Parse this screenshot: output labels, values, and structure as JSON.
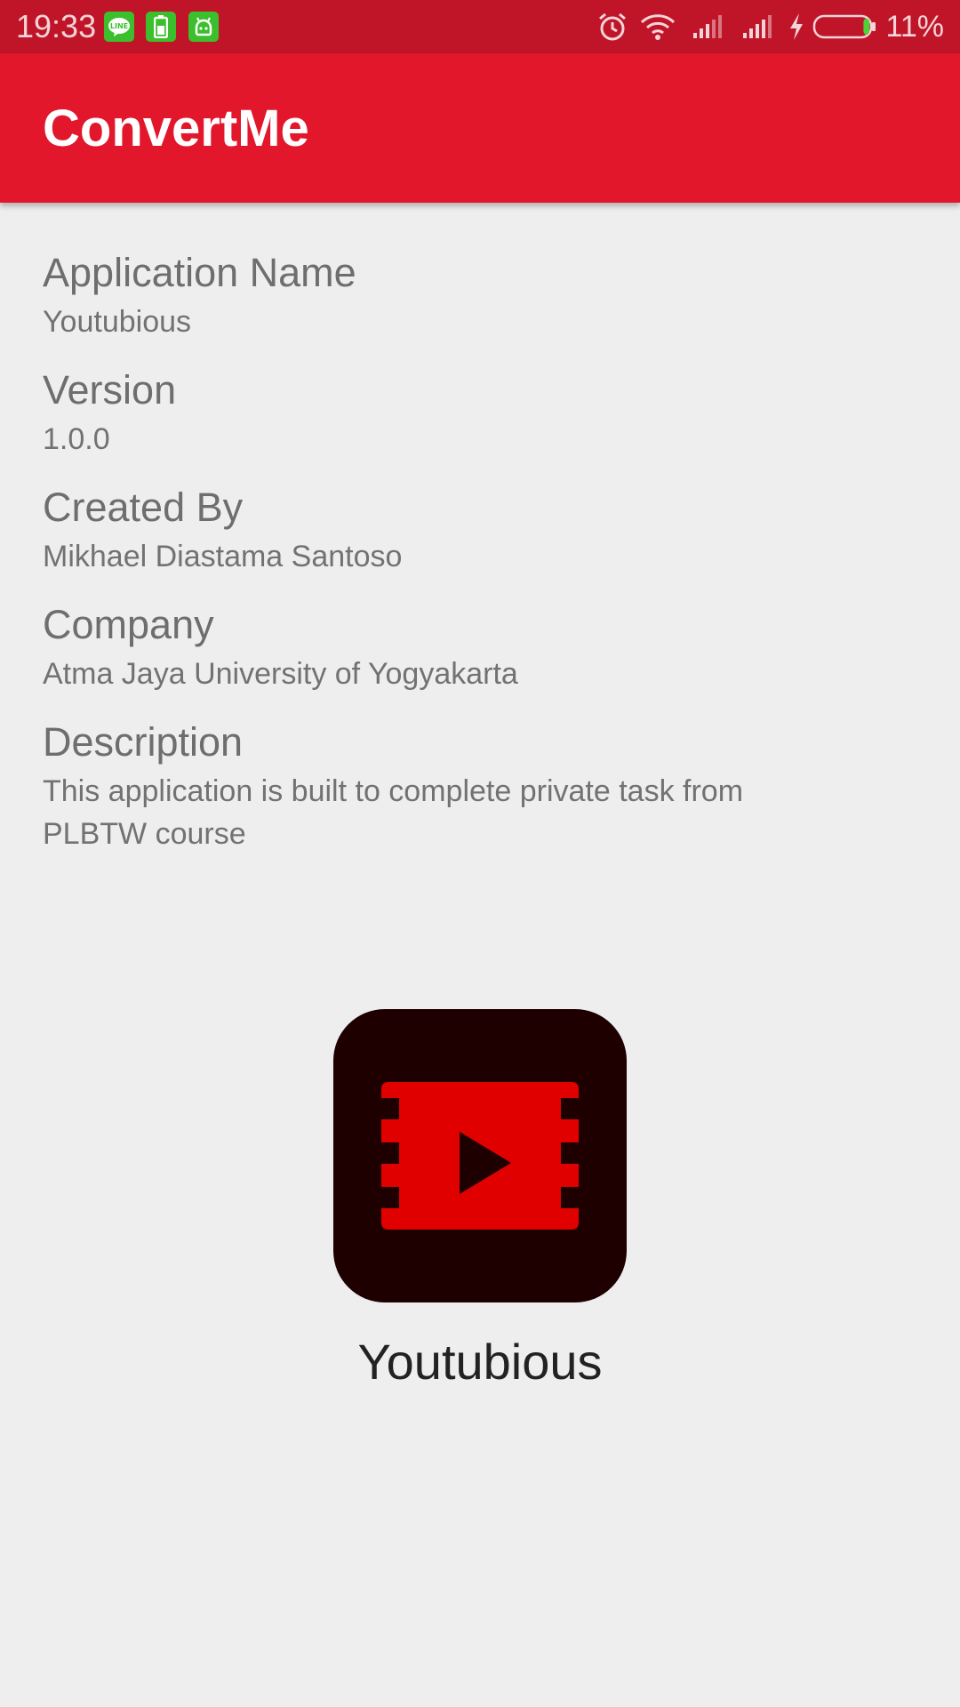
{
  "status_bar": {
    "time": "19:33",
    "notification_icons": [
      "line-icon",
      "battery-saver-icon",
      "android-icon"
    ],
    "system_icons": [
      "alarm-icon",
      "wifi-icon",
      "signal-icon",
      "signal-icon",
      "charging-icon",
      "battery-icon"
    ],
    "battery_percent": "11%",
    "battery_level": 0.11
  },
  "app_bar": {
    "title": "ConvertMe"
  },
  "info": [
    {
      "label": "Application Name",
      "value": "Youtubious"
    },
    {
      "label": "Version",
      "value": "1.0.0"
    },
    {
      "label": "Created By",
      "value": "Mikhael Diastama Santoso"
    },
    {
      "label": "Company",
      "value": "Atma Jaya University of Yogyakarta"
    },
    {
      "label": "Description",
      "value": "This application is built to complete private task from PLBTW course"
    }
  ],
  "app_icon": {
    "icon": "film-play-icon",
    "label": "Youtubious"
  },
  "colors": {
    "status_bar": "#c01428",
    "app_bar": "#e2172c",
    "background": "#eeeeee",
    "icon_background": "#1e0000",
    "icon_red": "#e00000"
  }
}
